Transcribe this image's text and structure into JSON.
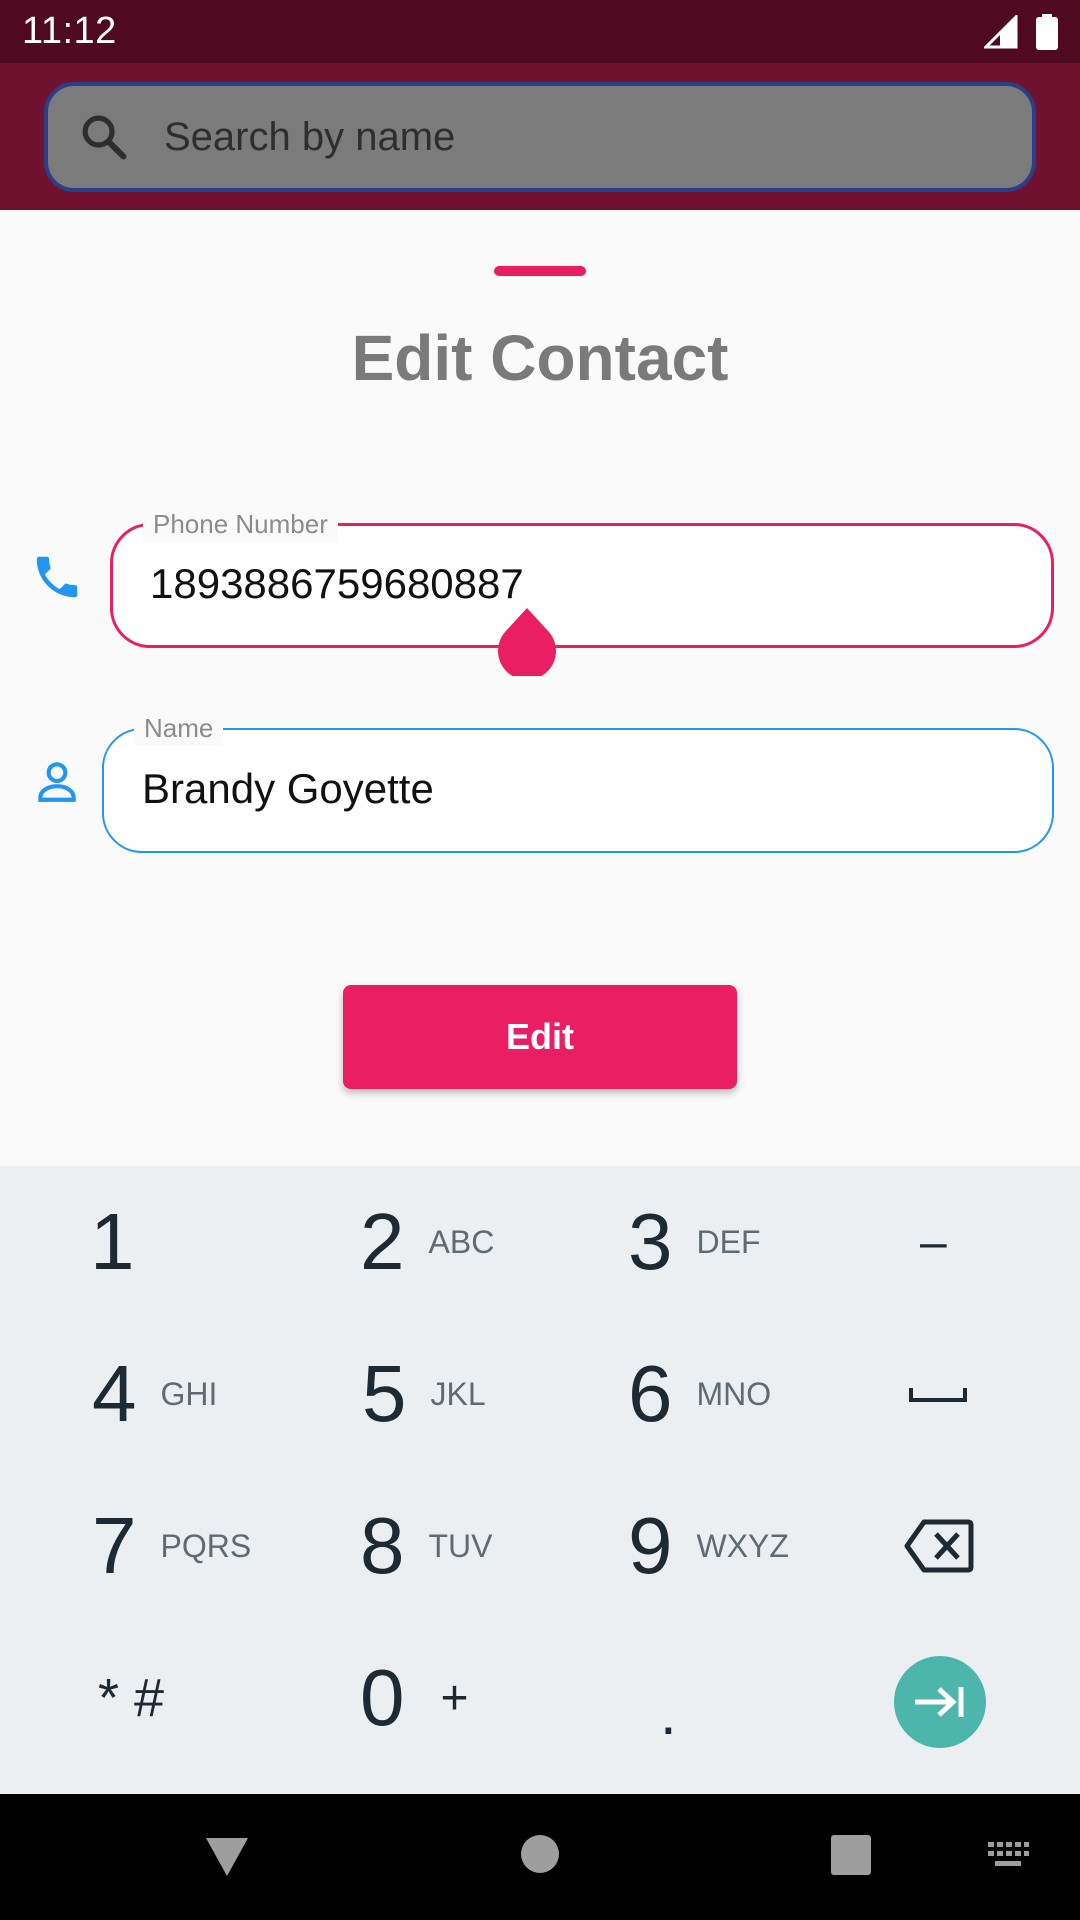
{
  "status_bar": {
    "time": "11:12"
  },
  "search": {
    "placeholder": "Search by name"
  },
  "sheet": {
    "title": "Edit Contact",
    "phone_label": "Phone Number",
    "phone_value": "1893886759680887",
    "name_label": "Name",
    "name_value": "Brandy Goyette",
    "edit_label": "Edit"
  },
  "keyboard": {
    "rows": [
      [
        {
          "digit": "1",
          "letters": ""
        },
        {
          "digit": "2",
          "letters": "ABC"
        },
        {
          "digit": "3",
          "letters": "DEF"
        },
        {
          "symbol": "–"
        }
      ],
      [
        {
          "digit": "4",
          "letters": "GHI"
        },
        {
          "digit": "5",
          "letters": "JKL"
        },
        {
          "digit": "6",
          "letters": "MNO"
        },
        {
          "symbol": "space-icon"
        }
      ],
      [
        {
          "digit": "7",
          "letters": "PQRS"
        },
        {
          "digit": "8",
          "letters": "TUV"
        },
        {
          "digit": "9",
          "letters": "WXYZ"
        },
        {
          "symbol": "backspace-icon"
        }
      ],
      [
        {
          "symbol": "* #"
        },
        {
          "digit": "0",
          "letters": "+"
        },
        {
          "symbol": "."
        },
        {
          "symbol": "next-field-icon"
        }
      ]
    ],
    "action_color": "#4db6ac"
  },
  "colors": {
    "accent": "#e91e63",
    "focus_blue": "#2196f3",
    "status_bar": "#4f0a22",
    "app_bar": "#6e1230"
  }
}
